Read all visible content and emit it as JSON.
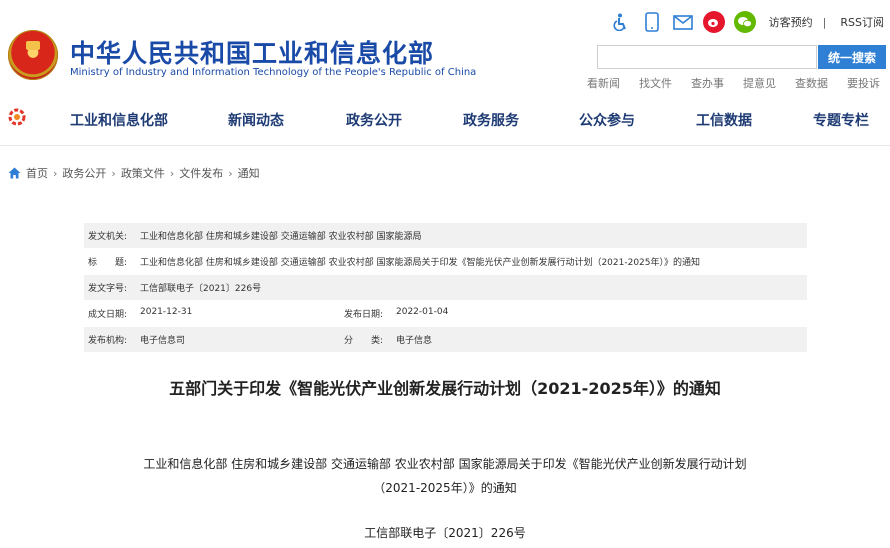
{
  "header": {
    "title": "中华人民共和国工业和信息化部",
    "subtitle": "Ministry of Industry and Information Technology of the People's Republic of China",
    "top_links": {
      "visitor": "访客预约",
      "separator": "|",
      "rss": "RSS订阅"
    },
    "icons": [
      "accessibility-icon",
      "mobile-icon",
      "mail-icon",
      "weibo-icon",
      "wechat-icon"
    ],
    "search": {
      "placeholder": "",
      "button": "统一搜索"
    },
    "quick_links": [
      "看新闻",
      "找文件",
      "查办事",
      "提意见",
      "查数据",
      "要投诉"
    ]
  },
  "nav": {
    "items": [
      "工业和信息化部",
      "新闻动态",
      "政务公开",
      "政务服务",
      "公众参与",
      "工信数据",
      "专题专栏"
    ]
  },
  "breadcrumb": [
    "首页",
    "政务公开",
    "政策文件",
    "文件发布",
    "通知"
  ],
  "info": {
    "issuer_label": "发文机关:",
    "issuer": "工业和信息化部 住房和城乡建设部 交通运输部 农业农村部 国家能源局",
    "title_label": "标　　题:",
    "title": "工业和信息化部 住房和城乡建设部 交通运输部 农业农村部 国家能源局关于印发《智能光伏产业创新发展行动计划（2021-2025年）》的通知",
    "docno_label": "发文字号:",
    "docno": "工信部联电子〔2021〕226号",
    "created_label": "成文日期:",
    "created": "2021-12-31",
    "published_label": "发布日期:",
    "published": "2022-01-04",
    "org_label": "发布机构:",
    "org": "电子信息司",
    "category_label": "分　　类:",
    "category": "电子信息"
  },
  "document": {
    "title": "五部门关于印发《智能光伏产业创新发展行动计划（2021-2025年）》的通知",
    "heading_line1": "工业和信息化部 住房和城乡建设部 交通运输部 农业农村部 国家能源局关于印发《智能光伏产业创新发展行动计划",
    "heading_line2": "（2021-2025年）》的通知",
    "docno": "工信部联电子〔2021〕226号"
  },
  "colors": {
    "brand": "#1a4aa7",
    "nav_text": "#1e3b74",
    "search_button": "#2f7fd5",
    "weibo": "#e6162d",
    "wechat": "#62b900"
  }
}
